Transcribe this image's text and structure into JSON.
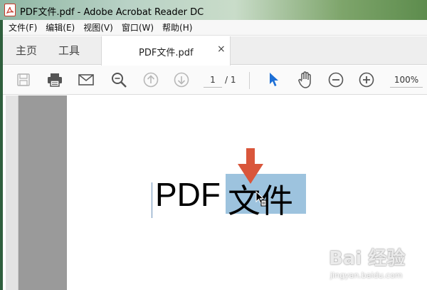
{
  "window": {
    "title": "PDF文件.pdf - Adobe Acrobat Reader DC"
  },
  "menu": {
    "items": [
      "文件(F)",
      "编辑(E)",
      "视图(V)",
      "窗口(W)",
      "帮助(H)"
    ]
  },
  "tabs": {
    "home": "主页",
    "tools": "工具",
    "document": "PDF文件.pdf",
    "close": "×"
  },
  "toolbar": {
    "icons": [
      "save-icon",
      "print-icon",
      "email-icon",
      "find-icon",
      "prev-page-icon",
      "next-page-icon",
      "select-cursor-icon",
      "hand-icon",
      "zoom-out-icon",
      "zoom-in-icon"
    ],
    "page_current": "1",
    "page_total": "/ 1",
    "zoom": "100%"
  },
  "document": {
    "text_plain": "PDF ",
    "text_selected": "文件"
  },
  "watermark": {
    "brand": "Bai 经验",
    "url": "jingyan.baidu.com"
  },
  "colors": {
    "selection": "#9dc3de",
    "annotation_arrow": "#d9563b",
    "cursor_active": "#1d6fd6",
    "gutter": "#9a9a9a"
  }
}
